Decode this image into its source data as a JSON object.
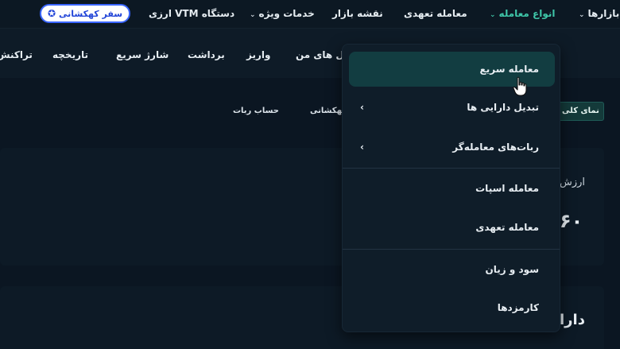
{
  "topnav": {
    "items": [
      {
        "label": "بازارها",
        "chevron": true
      },
      {
        "label": "انواع معامله",
        "chevron": true,
        "active": true
      },
      {
        "label": "معامله تعهدی",
        "chevron": false
      },
      {
        "label": "نقشه بازار",
        "chevron": false
      },
      {
        "label": "خدمات ویژه",
        "chevron": true
      },
      {
        "label": "دستگاه VTM ارزی",
        "chevron": false
      }
    ],
    "galaxy_button": "سفر کهکشانی",
    "galaxy_icon": "star-icon"
  },
  "subnav": {
    "items": [
      "ل های من",
      "واریز",
      "برداشت",
      "شارژ سریع",
      "تاریخچه",
      "تراکنش"
    ]
  },
  "tabs": {
    "active": "نمای کلی",
    "items": [
      "کهکشانی",
      "حساب ربات"
    ]
  },
  "cards": {
    "first_label": "ارزش",
    "first_value": "۶۰",
    "second_label": "دارا"
  },
  "dropdown": {
    "items": [
      {
        "label": "معامله سریع",
        "highlight": true,
        "submenu": false
      },
      {
        "label": "تبدیل دارایی ها",
        "highlight": false,
        "submenu": true
      },
      {
        "label": "ربات‌های معامله‌گر",
        "highlight": false,
        "submenu": true
      },
      {
        "label": "معامله اسپات",
        "highlight": false,
        "submenu": false
      },
      {
        "label": "معامله تعهدی",
        "highlight": false,
        "submenu": false
      },
      {
        "label": "سود و زیان",
        "highlight": false,
        "submenu": false
      },
      {
        "label": "کارمزدها",
        "highlight": false,
        "submenu": false
      }
    ]
  },
  "colors": {
    "accent": "#3ec6a8",
    "background": "#0b1622",
    "highlight": "#123d41",
    "galaxy_border": "#3a66ff"
  }
}
